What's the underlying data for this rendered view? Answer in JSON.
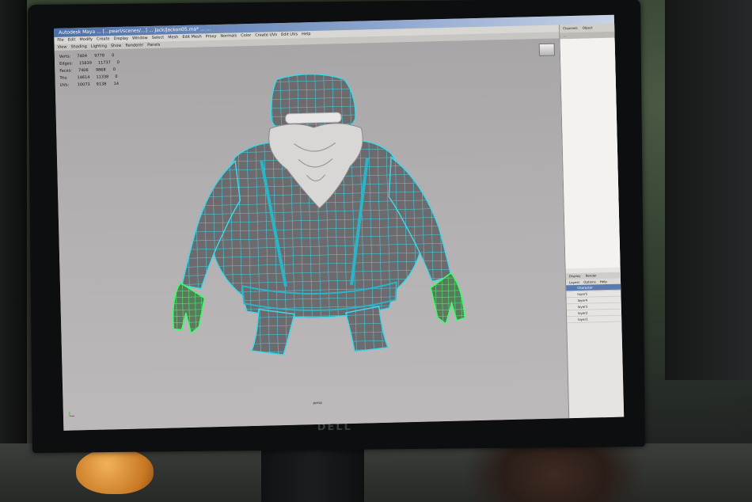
{
  "window": {
    "title": "Autodesk Maya ... [...pearl/scenes/...]  ... Jack/Jackon05.ma*  ...  ..."
  },
  "menu_bar": [
    "File",
    "Edit",
    "Modify",
    "Create",
    "Display",
    "Window",
    "Select",
    "Mesh",
    "Edit Mesh",
    "Proxy",
    "Normals",
    "Color",
    "Create UVs",
    "Edit UVs",
    "Help"
  ],
  "panel_menu": [
    "View",
    "Shading",
    "Lighting",
    "Show",
    "Renderer",
    "Panels"
  ],
  "hud": [
    {
      "label": "Verts:",
      "a": "7404",
      "b": "9778",
      "c": "0"
    },
    {
      "label": "Edges:",
      "a": "15839",
      "b": "11737",
      "c": "0"
    },
    {
      "label": "Faces:",
      "a": "7406",
      "b": "9868",
      "c": "0"
    },
    {
      "label": "Tris:",
      "a": "14614",
      "b": "11338",
      "c": "0"
    },
    {
      "label": "UVs:",
      "a": "10073",
      "b": "9138",
      "c": "14"
    }
  ],
  "right_panel": {
    "tabs": [
      "Channels",
      "Object"
    ],
    "header": "...",
    "bottom_tabs": [
      "Display",
      "Render"
    ],
    "bottom_menu": [
      "Layers",
      "Options",
      "Help"
    ],
    "layers": [
      "Character",
      "layer5",
      "layer4",
      "layer3",
      "layer2",
      "layer1"
    ]
  },
  "viewport": {
    "frame_label": "persp"
  },
  "monitor": {
    "brand": "DELL"
  },
  "colors": {
    "wire": "#3fd6e8",
    "selected_wire": "#3bff6a",
    "mesh": "#6c6a6c"
  }
}
